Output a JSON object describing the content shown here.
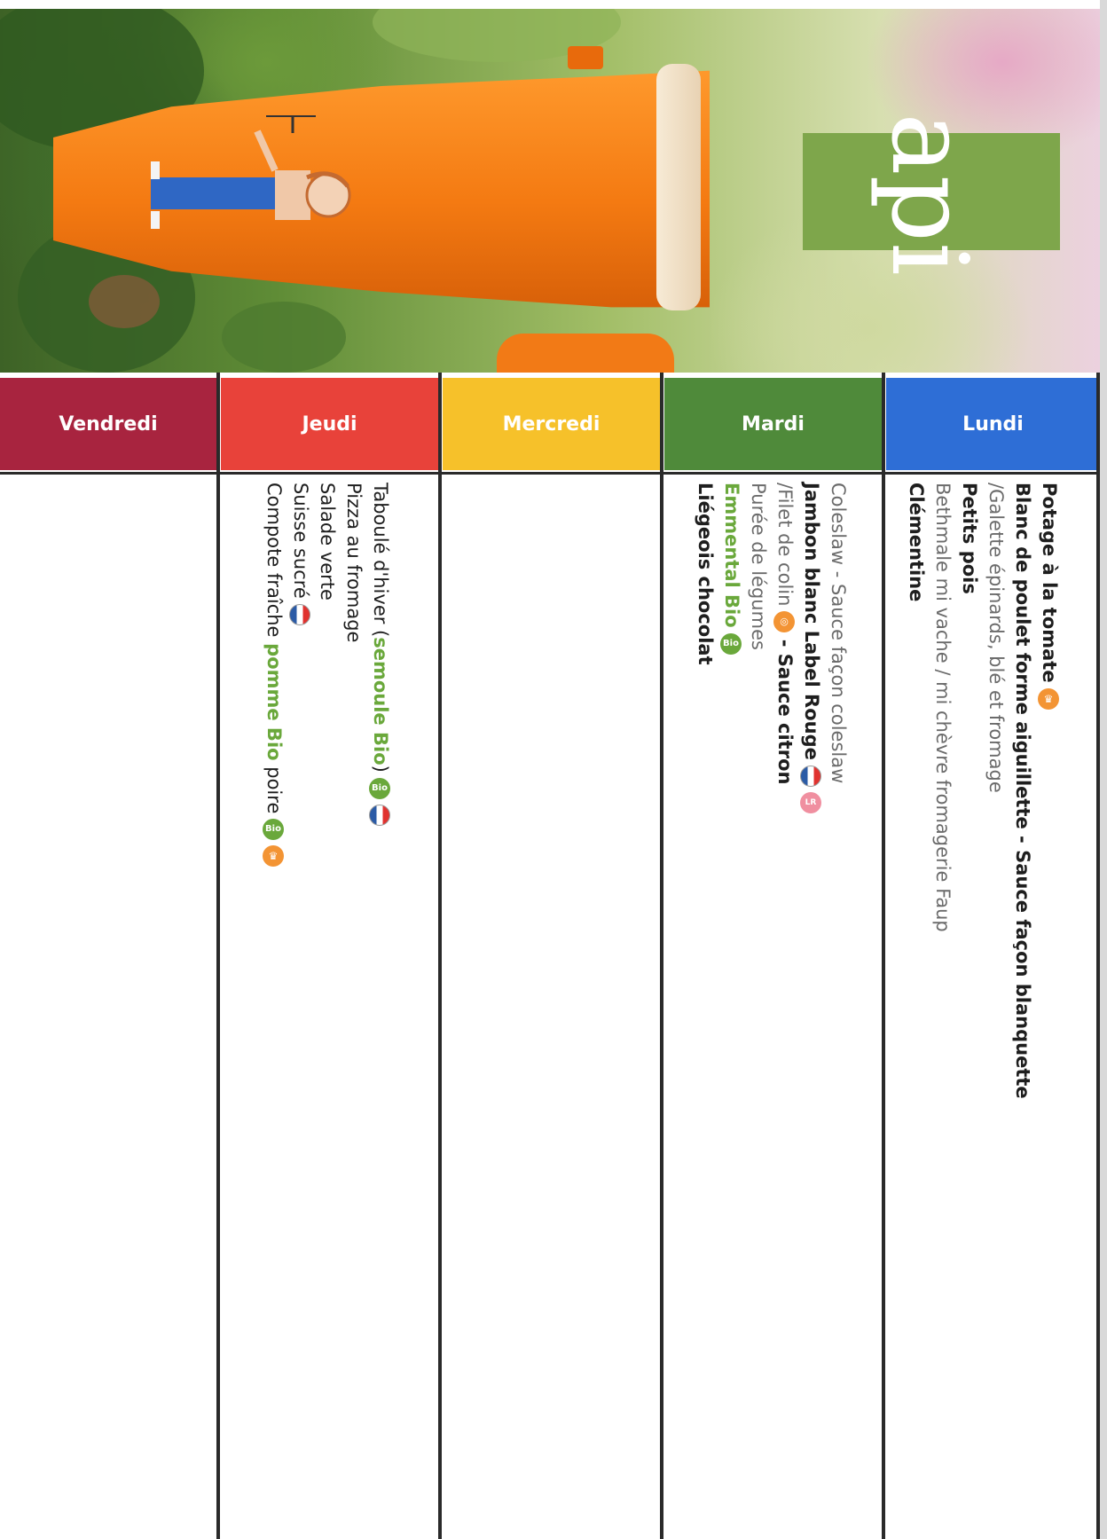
{
  "logo": {
    "text": "api"
  },
  "days": [
    {
      "label": "Lundi",
      "color": "#2e6ed6"
    },
    {
      "label": "Mardi",
      "color": "#4f8a3a"
    },
    {
      "label": "Mercredi",
      "color": "#f6c12a"
    },
    {
      "label": "Jeudi",
      "color": "#e8423a"
    },
    {
      "label": "Vendredi",
      "color": "#a8243f"
    }
  ],
  "menus": {
    "lundi": {
      "item1": "Potage à la tomate",
      "item2": "Blanc de poulet forme aiguillette - Sauce façon blanquette",
      "item3": "/Galette épinards, blé et fromage",
      "item4": "Petits pois",
      "item5": "Bethmale mi vache / mi chèvre fromagerie Faup",
      "item6": "Clémentine"
    },
    "mardi": {
      "item1": "Coleslaw - Sauce façon coleslaw",
      "item2": "Jambon blanc Label Rouge",
      "item3a": "/Filet de colin",
      "item3b": " - Sauce citron",
      "item4": "Purée de légumes",
      "item5": "Emmental Bio",
      "item6": "Liégeois chocolat"
    },
    "jeudi": {
      "item1a": "Taboulé d'hiver (",
      "item1b": "semoule Bio",
      "item1c": ")",
      "item2": "Pizza au fromage",
      "item3": "Salade verte",
      "item4": "Suisse sucré",
      "item5a": "Compote fraîche ",
      "item5b": "pomme Bio",
      "item5c": " poire"
    }
  },
  "icons": {
    "bio": "bio-badge-icon",
    "chef": "chef-hat-icon",
    "french": "french-flag-icon",
    "label_rouge": "label-rouge-icon",
    "sustainable_fishing": "sustainable-fishing-icon"
  }
}
